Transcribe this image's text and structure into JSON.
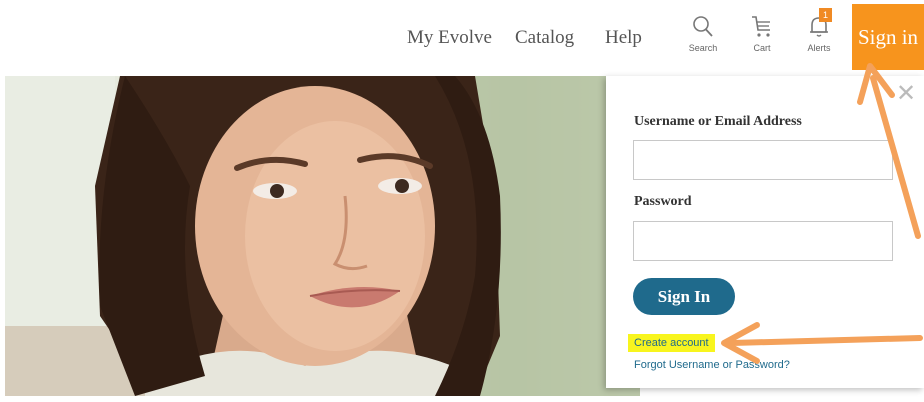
{
  "nav": {
    "links": [
      "My Evolve",
      "Catalog",
      "Help"
    ],
    "search_label": "Search",
    "cart_label": "Cart",
    "alerts_label": "Alerts",
    "alerts_count": "1",
    "signin_label": "Sign in"
  },
  "icons": {
    "search": "search-icon",
    "cart": "cart-icon",
    "alerts": "bell-icon",
    "close": "close-icon"
  },
  "login": {
    "close_glyph": "✕",
    "username_label": "Username or Email Address",
    "username_value": "",
    "password_label": "Password",
    "password_value": "",
    "submit_label": "Sign In",
    "create_account": "Create account",
    "forgot_link": "Forgot Username or Password?"
  },
  "colors": {
    "accent_orange": "#f7941d",
    "annotation_orange": "#f4a15a",
    "primary_blue": "#1f6a8c",
    "highlight_yellow": "#f8f51e"
  }
}
